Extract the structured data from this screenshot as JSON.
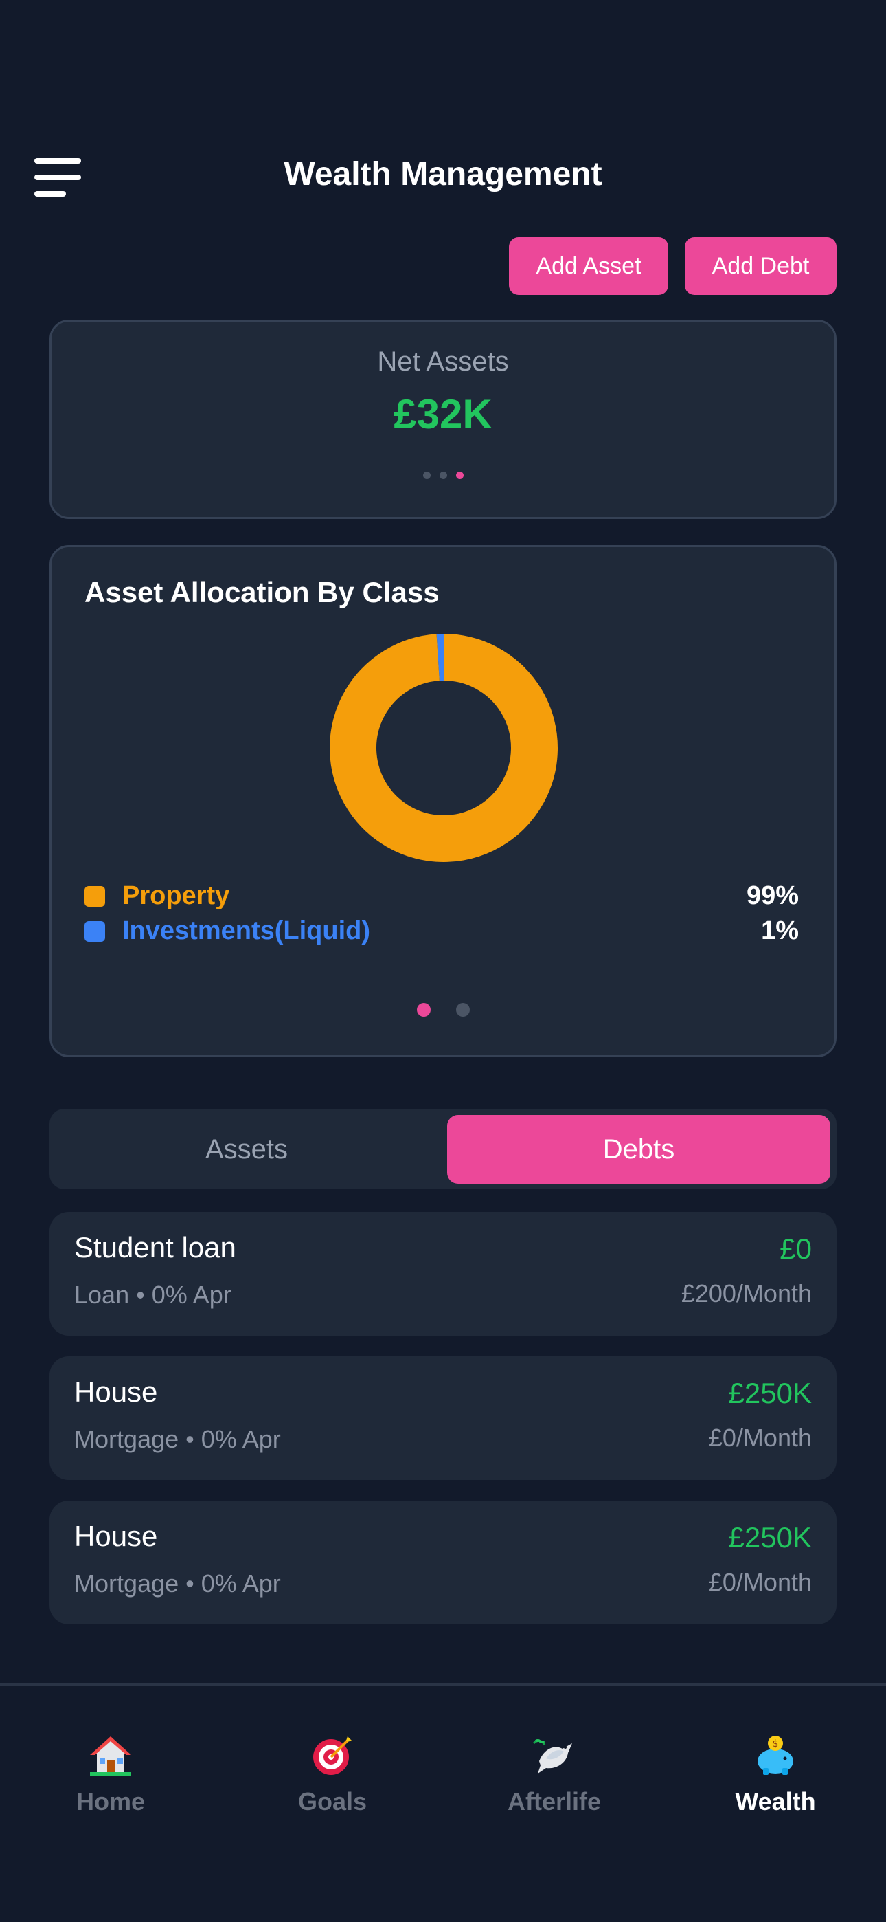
{
  "header": {
    "title": "Wealth Management",
    "add_asset": "Add Asset",
    "add_debt": "Add Debt"
  },
  "net_assets": {
    "label": "Net Assets",
    "value": "£32K",
    "carousel_pages": 3,
    "carousel_active": 3
  },
  "allocation": {
    "title": "Asset Allocation By Class",
    "carousel_pages": 2,
    "carousel_active": 1
  },
  "chart_data": {
    "type": "pie",
    "title": "Asset Allocation By Class",
    "categories": [
      "Property",
      "Investments(Liquid)"
    ],
    "values": [
      99,
      1
    ],
    "value_labels": [
      "99%",
      "1%"
    ],
    "colors": [
      "#f59e0b",
      "#3b82f6"
    ],
    "donut": true,
    "legend": "bottom"
  },
  "tabs": {
    "assets": "Assets",
    "debts": "Debts",
    "active": "debts"
  },
  "debts": [
    {
      "name": "Student loan",
      "sub": "Loan • 0% Apr",
      "amount": "£0",
      "monthly": "£200/Month"
    },
    {
      "name": "House",
      "sub": "Mortgage • 0% Apr",
      "amount": "£250K",
      "monthly": "£0/Month"
    },
    {
      "name": "House",
      "sub": "Mortgage • 0% Apr",
      "amount": "£250K",
      "monthly": "£0/Month"
    }
  ],
  "nav": {
    "home": {
      "label": "Home",
      "icon": "house-icon"
    },
    "goals": {
      "label": "Goals",
      "icon": "target-icon"
    },
    "afterlife": {
      "label": "Afterlife",
      "icon": "dove-icon"
    },
    "wealth": {
      "label": "Wealth",
      "icon": "piggy-bank-icon"
    },
    "active": "wealth"
  },
  "colors": {
    "accent": "#ec4899",
    "positive": "#22c55e",
    "background": "#121a2b",
    "card": "#1f2939"
  }
}
